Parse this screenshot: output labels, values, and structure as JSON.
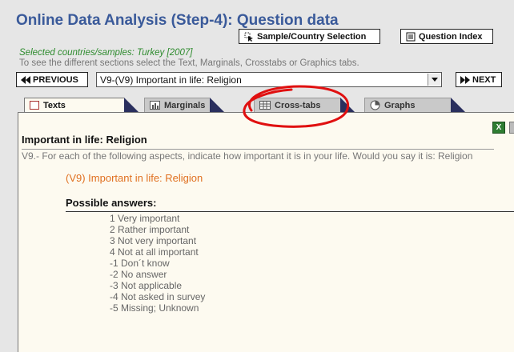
{
  "header": {
    "title": "Online Data Analysis (Step-4): Question data",
    "sample_btn": "Sample/Country Selection",
    "qindex_btn": "Question Index"
  },
  "info": {
    "selected": "Selected countries/samples: Turkey [2007]",
    "hint": "To see the different sections select the Text, Marginals, Crosstabs or Graphics tabs."
  },
  "nav": {
    "previous": "PREVIOUS",
    "next": "NEXT",
    "question_select": "V9-(V9) Important in life: Religion"
  },
  "tabs": [
    {
      "label": "Texts",
      "active": true
    },
    {
      "label": "Marginals",
      "active": false
    },
    {
      "label": "Cross-tabs",
      "active": false
    },
    {
      "label": "Graphs",
      "active": false
    }
  ],
  "content": {
    "heading": "Important in life: Religion",
    "question": "V9.- For each of the following aspects, indicate how important it is in your life. Would you say it is: Religion",
    "variable_label": "(V9) Important in life: Religion",
    "answers_heading": "Possible answers:",
    "answers": [
      "1 Very important",
      "2 Rather important",
      "3 Not very important",
      "4 Not at all important",
      "-1 Don´t know",
      "-2 No answer",
      "-3 Not applicable",
      "-4 Not asked in survey",
      "-5 Missing; Unknown"
    ]
  },
  "icons": {
    "sample": "cursor-select-icon",
    "index": "list-icon",
    "excel": "excel-icon",
    "texts_tab": "document-icon",
    "marginals_tab": "bar-chart-icon",
    "crosstabs_tab": "table-icon",
    "graphs_tab": "pie-chart-icon"
  },
  "annotation": {
    "color": "#e01010"
  }
}
